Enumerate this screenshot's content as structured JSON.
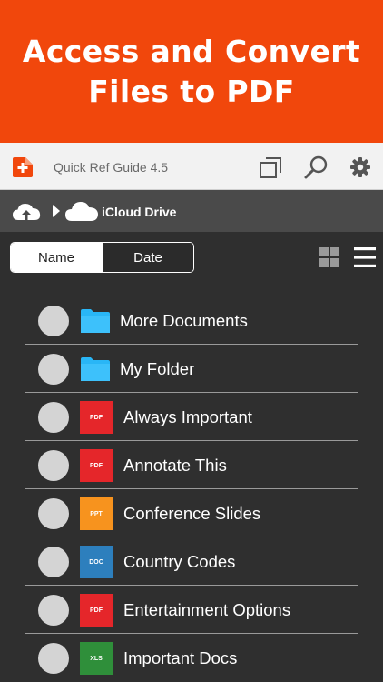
{
  "banner": {
    "title": "Access and Convert\nFiles to PDF"
  },
  "toolbar": {
    "document_title": "Quick Ref Guide 4.5",
    "icons": [
      "add-document-icon",
      "copy-pages-icon",
      "search-icon",
      "gear-icon"
    ]
  },
  "pathbar": {
    "location_label": "iCloud Drive"
  },
  "sort": {
    "name_label": "Name",
    "date_label": "Date",
    "selected": "Name"
  },
  "files": [
    {
      "name": "More Documents",
      "type": "folder"
    },
    {
      "name": "My Folder",
      "type": "folder"
    },
    {
      "name": "Always Important",
      "type": "PDF"
    },
    {
      "name": "Annotate This",
      "type": "PDF"
    },
    {
      "name": "Conference Slides",
      "type": "PPT"
    },
    {
      "name": "Country Codes",
      "type": "DOC"
    },
    {
      "name": "Entertainment Options",
      "type": "PDF"
    },
    {
      "name": "Important Docs",
      "type": "XLS"
    }
  ],
  "colors": {
    "accent": "#f1470c",
    "folder": "#29b6f6",
    "pdf": "#e5262a",
    "ppt": "#f7931e",
    "doc": "#2d7fbd",
    "xls": "#2f8f3a"
  }
}
